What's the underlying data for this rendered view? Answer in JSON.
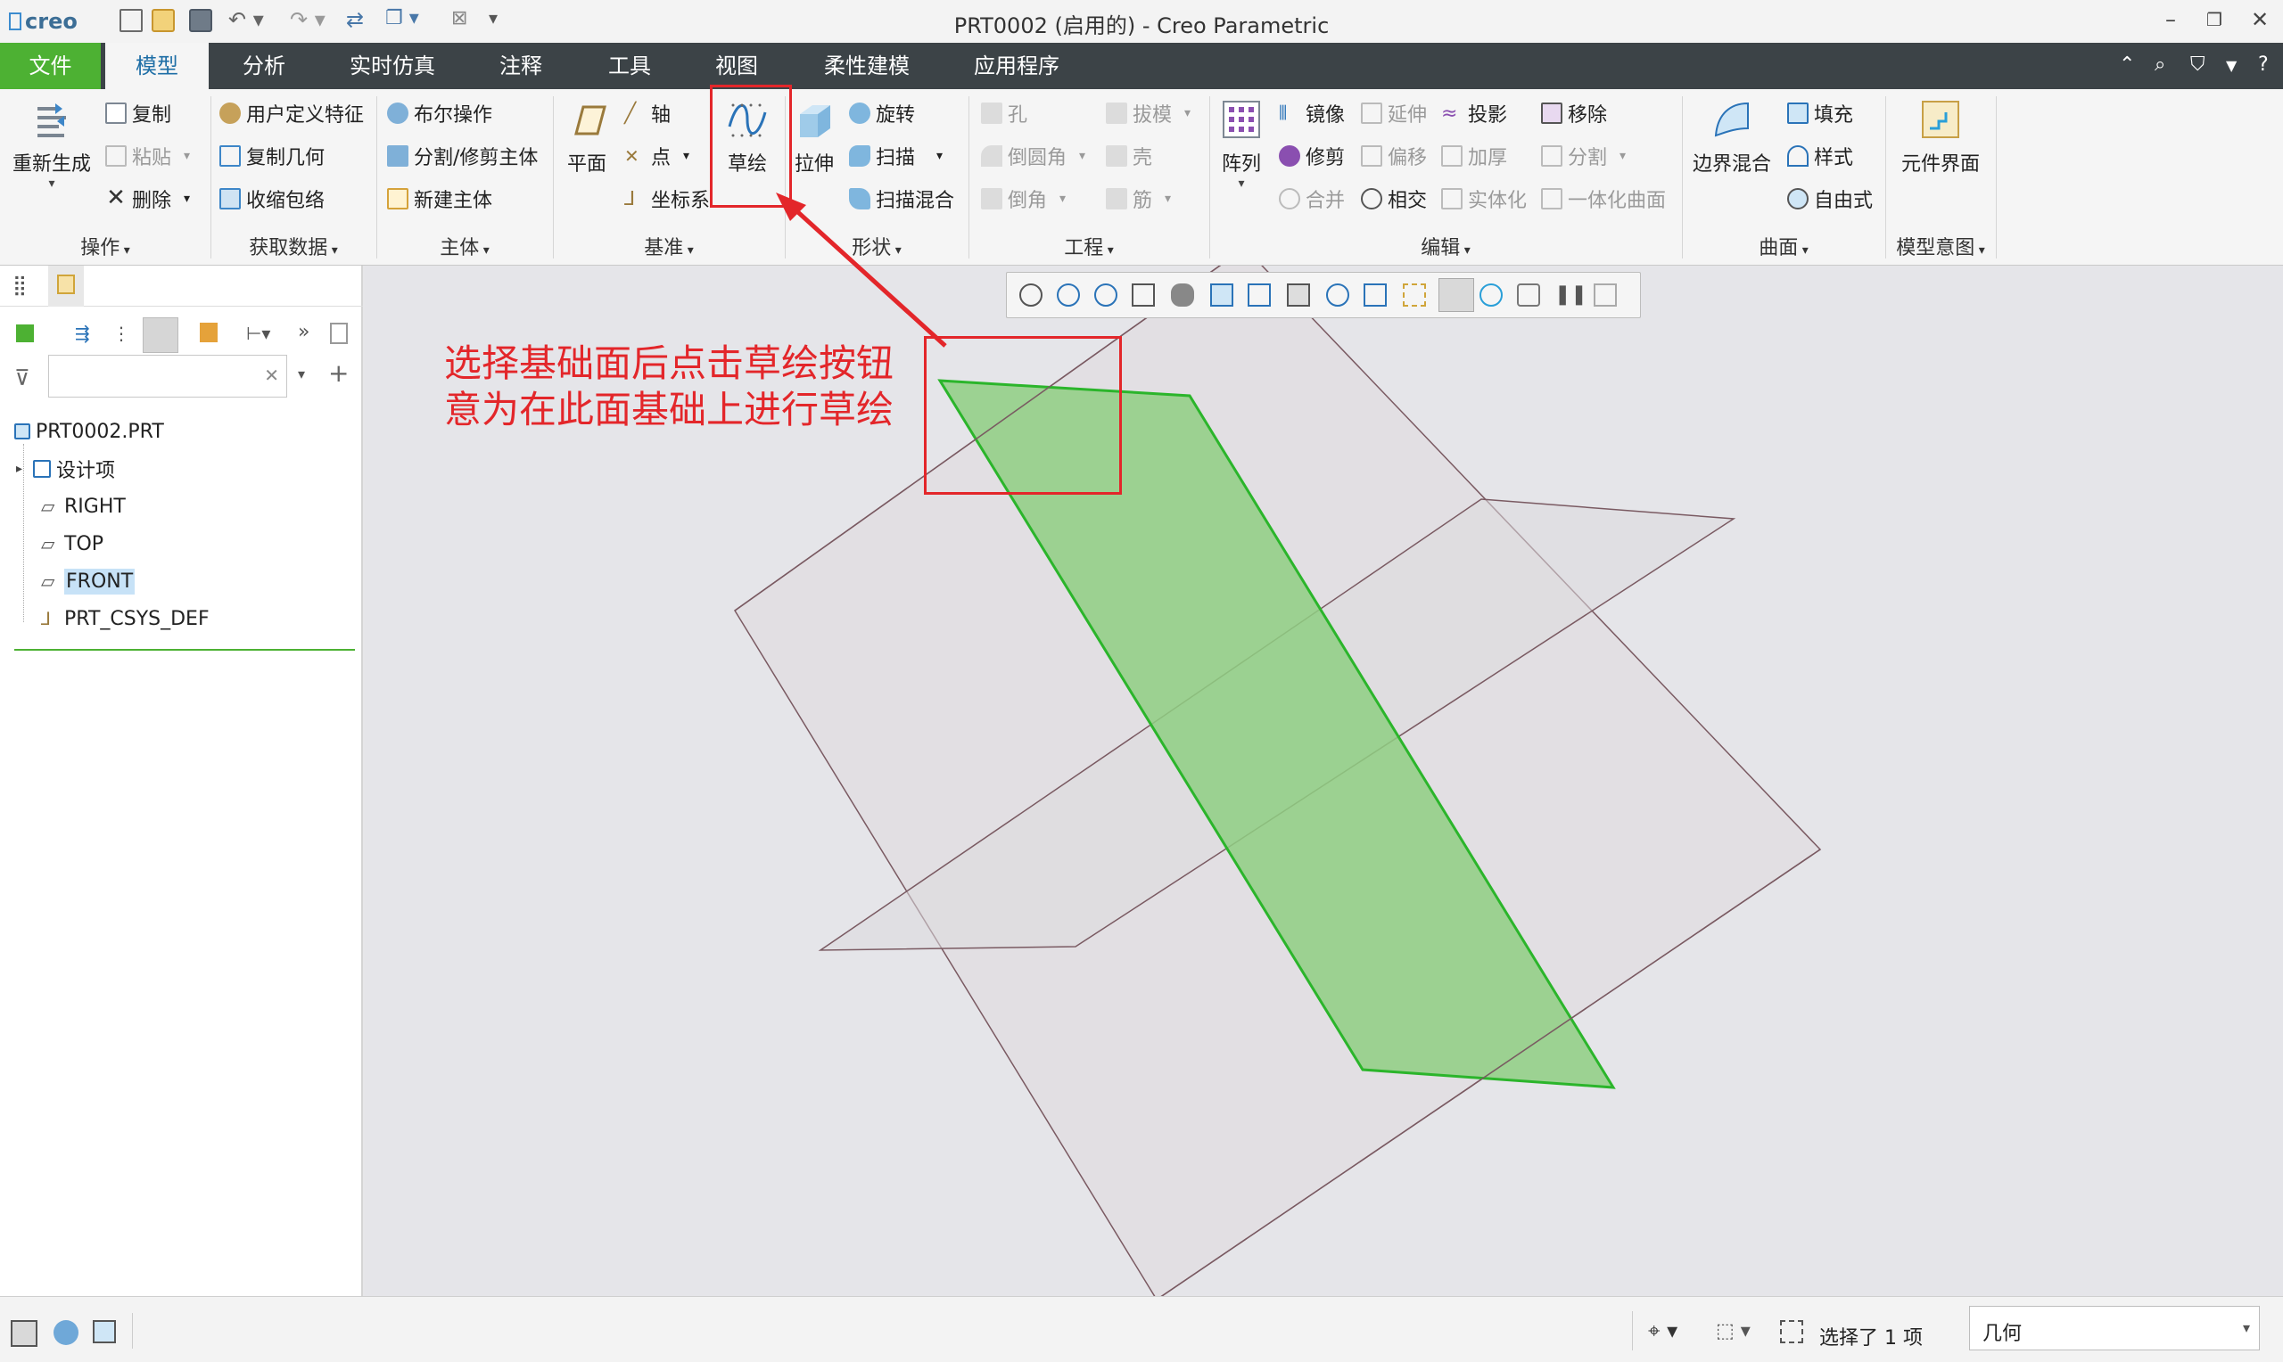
{
  "app": {
    "logo_text": "creo",
    "window_title": "PRT0002 (启用的) - Creo Parametric"
  },
  "tabs": [
    "文件",
    "模型",
    "分析",
    "实时仿真",
    "注释",
    "工具",
    "视图",
    "柔性建模",
    "应用程序"
  ],
  "ribbon": {
    "operations": {
      "label": "操作",
      "regen": "重新生成",
      "copy": "复制",
      "paste": "粘贴",
      "delete": "删除"
    },
    "get_data": {
      "label": "获取数据",
      "udf": "用户定义特征",
      "copy_geom": "复制几何",
      "shrinkwrap": "收缩包络"
    },
    "body": {
      "label": "主体",
      "boolean": "布尔操作",
      "split": "分割/修剪主体",
      "new_body": "新建主体"
    },
    "datum": {
      "label": "基准",
      "plane": "平面",
      "axis": "轴",
      "point": "点",
      "csys": "坐标系",
      "sketch": "草绘"
    },
    "shapes": {
      "label": "形状",
      "extrude": "拉伸",
      "revolve": "旋转",
      "sweep": "扫描",
      "swept_blend": "扫描混合"
    },
    "engineering": {
      "label": "工程",
      "hole": "孔",
      "round": "倒圆角",
      "chamfer": "倒角",
      "draft": "拔模",
      "shell": "壳",
      "rib": "筋"
    },
    "editing": {
      "label": "编辑",
      "pattern": "阵列",
      "mirror": "镜像",
      "trim": "修剪",
      "merge": "合并",
      "extend": "延伸",
      "offset": "偏移",
      "intersect": "相交",
      "project": "投影",
      "thicken": "加厚",
      "solidify": "实体化",
      "remove": "移除",
      "split": "分割",
      "unify": "一体化曲面"
    },
    "surfaces": {
      "label": "曲面",
      "boundary": "边界混合",
      "fill": "填充",
      "style": "样式",
      "freestyle": "自由式"
    },
    "model_intent": {
      "label": "模型意图",
      "component_interface": "元件界面"
    }
  },
  "tree": {
    "root": "PRT0002.PRT",
    "items": [
      "设计项",
      "RIGHT",
      "TOP",
      "FRONT",
      "PRT_CSYS_DEF"
    ],
    "selected": "FRONT"
  },
  "annotation": {
    "line1": "选择基础面后点击草绘按钮",
    "line2": "意为在此面基础上进行草绘",
    "color": "#e3262a"
  },
  "status": {
    "selection": "选择了 1 项",
    "filter_value": "几何"
  },
  "colors": {
    "accent_green": "#4db133",
    "active_tab_text": "#1e6ea6",
    "plane_selected_fill": "#8fcf83",
    "plane_selected_edge": "#2bb52b",
    "plane_edge": "#7a5a62"
  }
}
